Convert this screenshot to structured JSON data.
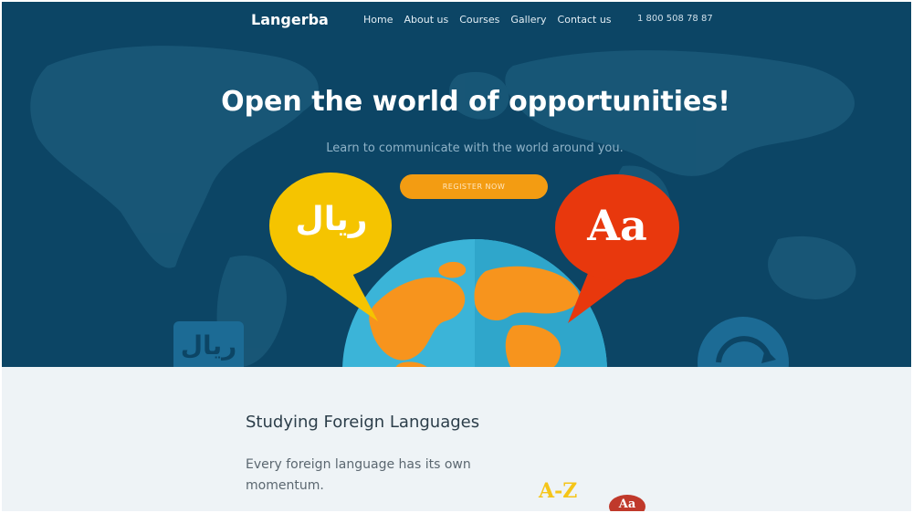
{
  "nav": {
    "logo": "Langerba",
    "items": [
      "Home",
      "About us",
      "Courses",
      "Gallery",
      "Contact us"
    ],
    "phone": "1 800 508 78 87"
  },
  "hero": {
    "headline": "Open the world of opportunities!",
    "subtitle": "Learn to communicate with the world around you.",
    "cta_label": "REGISTER NOW",
    "bubble_left_text": "ريال",
    "bubble_right_text": "Aa",
    "tile_left_text": "ريال"
  },
  "about": {
    "title": "Studying Foreign Languages",
    "text": "Every foreign language has its own momentum.",
    "badge_az": "A-Z",
    "badge_aa": "Aa"
  },
  "colors": {
    "hero_bg": "#0c4565",
    "accent": "#f39c12",
    "bubble_yellow": "#f5c400",
    "bubble_red": "#e8380d",
    "globe_ocean": "#3bb4d8",
    "globe_land": "#f7941d"
  }
}
